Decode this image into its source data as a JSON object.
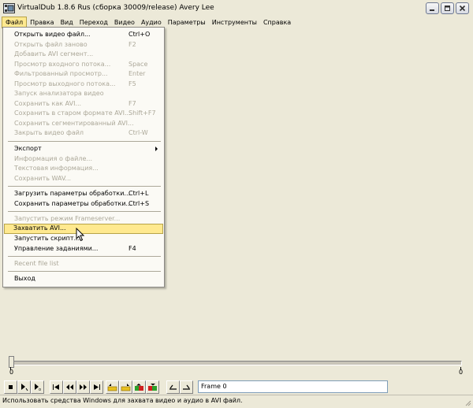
{
  "window": {
    "title": "VirtualDub 1.8.6 Rus (сборка 30009/release) Avery Lee",
    "buttons": [
      "minimize",
      "restore",
      "close"
    ]
  },
  "menubar": [
    "Файл",
    "Правка",
    "Вид",
    "Переход",
    "Видео",
    "Аудио",
    "Параметры",
    "Инструменты",
    "Справка"
  ],
  "file_menu": [
    {
      "label": "Открыть видео файл...",
      "shortcut": "Ctrl+O",
      "disabled": false
    },
    {
      "label": "Открыть файл заново",
      "shortcut": "F2",
      "disabled": true
    },
    {
      "label": "Добавить AVI сегмент...",
      "shortcut": "",
      "disabled": true
    },
    {
      "label": "Просмотр входного потока...",
      "shortcut": "Space",
      "disabled": true
    },
    {
      "label": "Фильтрованный просмотр...",
      "shortcut": "Enter",
      "disabled": true
    },
    {
      "label": "Просмотр выходного потока...",
      "shortcut": "F5",
      "disabled": true
    },
    {
      "label": "Запуск анализатора видео",
      "shortcut": "",
      "disabled": true
    },
    {
      "label": "Сохранить как AVI...",
      "shortcut": "F7",
      "disabled": true
    },
    {
      "label": "Сохранить в старом формате AVI...",
      "shortcut": "Shift+F7",
      "disabled": true
    },
    {
      "label": "Сохранить сегментированный AVI...",
      "shortcut": "",
      "disabled": true
    },
    {
      "label": "Закрыть видео файл",
      "shortcut": "Ctrl-W",
      "disabled": true
    },
    {
      "label": "Экспорт",
      "shortcut": "",
      "disabled": false,
      "submenu": true
    },
    {
      "label": "Информация о файле...",
      "shortcut": "",
      "disabled": true
    },
    {
      "label": "Текстовая информация...",
      "shortcut": "",
      "disabled": true
    },
    {
      "label": "Сохранить WAV...",
      "shortcut": "",
      "disabled": true
    },
    {
      "label": "Загрузить параметры обработки...",
      "shortcut": "Ctrl+L",
      "disabled": false
    },
    {
      "label": "Сохранить параметры обработки...",
      "shortcut": "Ctrl+S",
      "disabled": false
    },
    {
      "label": "Запустить режим Frameserver...",
      "shortcut": "",
      "disabled": true
    },
    {
      "label": "Захватить AVI...",
      "shortcut": "",
      "disabled": false,
      "highlighted": true
    },
    {
      "label": "Запустить скрипт...",
      "shortcut": "",
      "disabled": false
    },
    {
      "label": "Управление заданиями...",
      "shortcut": "F4",
      "disabled": false
    },
    {
      "label": "Recent file list",
      "shortcut": "",
      "disabled": true
    },
    {
      "label": "Выход",
      "shortcut": "",
      "disabled": false
    }
  ],
  "timeline": {
    "position": 0,
    "start_label": "0",
    "end_label": "0"
  },
  "toolbar": {
    "frame_readout": "Frame 0",
    "icons": [
      "stop-icon",
      "play-input-icon",
      "play-output-icon",
      "go-start-icon",
      "step-back-icon",
      "step-forward-icon",
      "go-end-icon",
      "prev-keyframe-icon",
      "next-keyframe-icon",
      "scene-back-icon",
      "scene-forward-icon",
      "mark-in-icon",
      "mark-out-icon"
    ]
  },
  "statusbar": {
    "text": "Использовать средства Windows для захвата видео и аудио в AVI файл."
  },
  "colors": {
    "menu_highlight": "#ffe98f",
    "disabled_text": "#aca899",
    "face": "#ece9d8"
  }
}
